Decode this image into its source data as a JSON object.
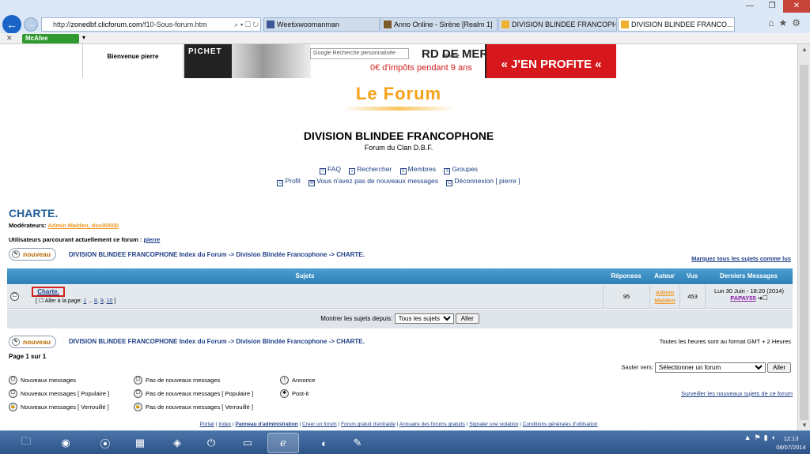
{
  "browser": {
    "address": {
      "prefix": "http://",
      "host": "zonedbf.clicforum.com",
      "path": "/f10-Sous-forum.htm",
      "controls": "⌕ ▾ ☐ ↻"
    },
    "tabs": [
      "Weetixwoomanman",
      "Anno Online - Sirène [Realm 1]",
      "DIVISION BLINDEE FRANCOPH...",
      "DIVISION BLINDEE FRANCO..."
    ],
    "toolbar": {
      "mcafee": "McAfee"
    }
  },
  "header": {
    "welcome": "Bienvenue pierre",
    "ad": {
      "brand": "PICHET",
      "google": "Google Recherche personnalisée",
      "headline": "RD DE MER",
      "iphone": "iPhone",
      "tax": "0€ d'impôts pendant 9 ans",
      "cta": "J'EN PROFITE"
    }
  },
  "forum": {
    "logo": "Le Forum",
    "site_title": "DIVISION BLINDEE FRANCOPHONE",
    "site_desc": "Forum du Clan D.B.F.",
    "nav1": [
      "FAQ",
      "Rechercher",
      "Membres",
      "Groupes"
    ],
    "nav2": [
      "Profil",
      "Vous n'avez pas de nouveaux messages",
      "Déconnexion [ pierre ]"
    ],
    "title": "CHARTE.",
    "moderators_label": "Modérateurs: ",
    "moderators": "Admin Malden, doc80500",
    "users_label": "Utilisateurs parcourant actuellement ce forum : ",
    "users": "pierre",
    "new_button": "nouveau",
    "breadcrumb": {
      "index": "DIVISION BLINDEE FRANCOPHONE Index du Forum",
      "sep": " -> ",
      "parent": "Division Blindée Francophone",
      "current": "CHARTE."
    },
    "mark_all": "Marquez tous les sujets comme lus",
    "table": {
      "headers": {
        "subjects": "Sujets",
        "replies": "Réponses",
        "author": "Auteur",
        "views": "Vus",
        "last": "Derniers Messages"
      },
      "row": {
        "topic": "Charte.",
        "goto_label": "[ ☐ Aller à la page: ",
        "pages": [
          "1",
          "...",
          "8",
          "9",
          "10"
        ],
        "goto_end": " ]",
        "replies": "95",
        "author": "Admin Malden",
        "views": "453",
        "last_date": "Lun 30 Juin - 18:20 (2014)",
        "last_user": "PAPAY55"
      },
      "footer": {
        "label": "Montrer les sujets depuis: ",
        "select": "Tous les sujets",
        "go": "Aller"
      }
    },
    "timezone": "Toutes les heures sont au format GMT + 2 Heures",
    "page_of": "Page 1 sur 1",
    "jump": {
      "label": "Sauter vers: ",
      "select": "Sélectionner un forum",
      "go": "Aller"
    },
    "legend": [
      "Nouveaux messages",
      "Pas de nouveaux messages",
      "Annonce",
      "Nouveaux messages [ Populaire ]",
      "Pas de nouveaux messages [ Populaire ]",
      "Post-it",
      "Nouveaux messages [ Verrouillé ]",
      "Pas de nouveaux messages [ Verrouillé ]"
    ],
    "watch": "Surveiller les nouveaux sujets de ce forum",
    "footer": [
      "Portail",
      "Index",
      "Panneau d'administration",
      "Creer un forum",
      "Forum gratuit d'entraide",
      "Annuaire des forums gratuits",
      "Signaler une violation",
      "Conditions générales d'utilisation"
    ]
  },
  "taskbar": {
    "time": "12:13",
    "date": "08/07/2014"
  }
}
